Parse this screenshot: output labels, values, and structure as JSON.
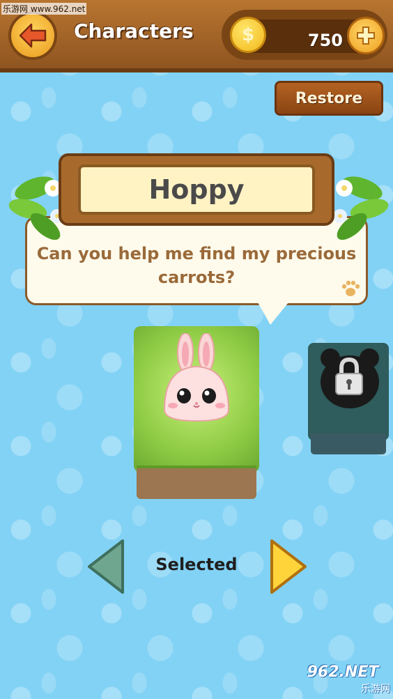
{
  "watermark": "乐游网 www.962.net",
  "header": {
    "title": "Characters",
    "coins": "750",
    "coin_symbol": "$"
  },
  "restore_label": "Restore",
  "character": {
    "name": "Hoppy",
    "dialogue": "Can you help me find my precious carrots?",
    "status": "Selected"
  },
  "next_character": {
    "locked": true
  },
  "site_logo": {
    "main": "962.NET",
    "sub": "乐游网"
  },
  "colors": {
    "header_wood": "#8f5520",
    "background_sky": "#82d2f5",
    "accent_gold": "#f2b81a",
    "name_text": "#4a4a4a",
    "dialogue_text": "#9a6a3a"
  },
  "icons": {
    "back": "back-arrow-icon",
    "coin": "coin-icon",
    "add": "plus-icon",
    "paw": "paw-icon",
    "lock": "lock-icon",
    "prev": "left-arrow-icon",
    "next": "right-arrow-icon"
  }
}
